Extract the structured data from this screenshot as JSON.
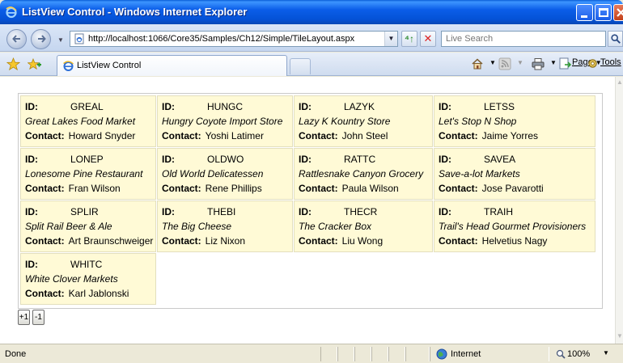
{
  "window": {
    "title": "ListView Control - Windows Internet Explorer"
  },
  "address": {
    "url": "http://localhost:1066/Core35/Samples/Ch12/Simple/TileLayout.aspx"
  },
  "search": {
    "placeholder": "Live Search"
  },
  "tab": {
    "label": "ListView Control"
  },
  "commands": {
    "page_label": "Page",
    "tools_label": "Tools"
  },
  "listview": {
    "id_label": "ID:",
    "contact_label": "Contact:",
    "customers": [
      {
        "id": "GREAL",
        "name": "Great Lakes Food Market",
        "contact": "Howard Snyder"
      },
      {
        "id": "HUNGC",
        "name": "Hungry Coyote Import Store",
        "contact": "Yoshi Latimer"
      },
      {
        "id": "LAZYK",
        "name": "Lazy K Kountry Store",
        "contact": "John Steel"
      },
      {
        "id": "LETSS",
        "name": "Let's Stop N Shop",
        "contact": "Jaime Yorres"
      },
      {
        "id": "LONEP",
        "name": "Lonesome Pine Restaurant",
        "contact": "Fran Wilson"
      },
      {
        "id": "OLDWO",
        "name": "Old World Delicatessen",
        "contact": "Rene Phillips"
      },
      {
        "id": "RATTC",
        "name": "Rattlesnake Canyon Grocery",
        "contact": "Paula Wilson"
      },
      {
        "id": "SAVEA",
        "name": "Save-a-lot Markets",
        "contact": "Jose Pavarotti"
      },
      {
        "id": "SPLIR",
        "name": "Split Rail Beer & Ale",
        "contact": "Art Braunschweiger"
      },
      {
        "id": "THEBI",
        "name": "The Big Cheese",
        "contact": "Liz Nixon"
      },
      {
        "id": "THECR",
        "name": "The Cracker Box",
        "contact": "Liu Wong"
      },
      {
        "id": "TRAIH",
        "name": "Trail's Head Gourmet Provisioners",
        "contact": "Helvetius Nagy"
      },
      {
        "id": "WHITC",
        "name": "White Clover Markets",
        "contact": "Karl Jablonski"
      }
    ]
  },
  "pager": {
    "plus_label": "+1",
    "minus_label": "-1"
  },
  "status": {
    "text": "Done",
    "zone": "Internet",
    "zoom": "100%"
  },
  "colors": {
    "tile_background": "#fffad6",
    "titlebar": "#0b5de8"
  }
}
